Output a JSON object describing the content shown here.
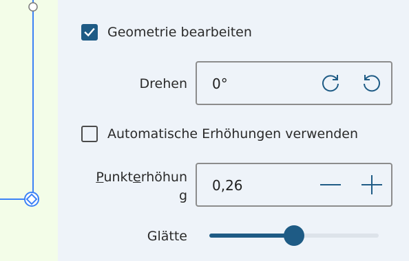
{
  "colors": {
    "accent": "#1e5b85",
    "canvas_bg": "#f3fde8",
    "panel_bg": "#eef3f9",
    "line": "#3b82f6"
  },
  "geometry_edit": {
    "label": "Geometrie bearbeiten",
    "checked": true
  },
  "rotate": {
    "label": "Drehen",
    "value": "0°",
    "rotate_cw_icon": "rotate-clockwise-icon",
    "rotate_ccw_icon": "rotate-counterclockwise-icon"
  },
  "auto_heights": {
    "label": "Automatische Erhöhungen verwenden",
    "checked": false
  },
  "point_height": {
    "label_line1_prefix": "P",
    "label_line1_rest1": "unkt",
    "label_line1_mn": "e",
    "label_line1_rest2": "rhöhun",
    "label_line2": "g",
    "value": "0,26",
    "decrement_icon": "minus-icon",
    "increment_icon": "plus-icon"
  },
  "smoothness": {
    "label": "Glätte",
    "level": 0.5
  }
}
